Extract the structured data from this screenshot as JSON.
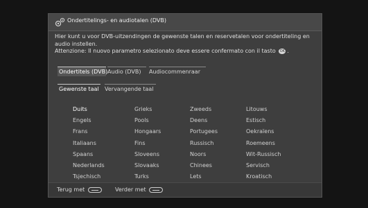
{
  "header": {
    "title": "Ondertitelings- en audiotalen (DVB)",
    "icon": "gears-icon"
  },
  "description": {
    "line1": "Hier kunt u voor DVB-uitzendingen de gewenste talen en reservetalen voor ondertiteling en audio instellen.",
    "line2_before": "Attenzione: Il nuovo parametro selezionato deve essere confermato con il tasto",
    "ok_key": "OK",
    "line2_after": "."
  },
  "tabs": [
    {
      "label": "Ondertitels (DVB)"
    },
    {
      "label": "Audio (DVB)"
    },
    {
      "label": "Audiocommenraar"
    }
  ],
  "subtabs": [
    {
      "label": "Gewenste taal"
    },
    {
      "label": "Vervangende taal"
    }
  ],
  "languages": {
    "columns": [
      [
        "Duits",
        "Engels",
        "Frans",
        "Italiaans",
        "Spaans",
        "Nederlands",
        "Tsjechisch"
      ],
      [
        "Grieks",
        "Pools",
        "Hongaars",
        "Fins",
        "Sloveens",
        "Slovaaks",
        "Turks"
      ],
      [
        "Zweeds",
        "Deens",
        "Portugees",
        "Russisch",
        "Noors",
        "Chinees",
        "Lets"
      ],
      [
        "Litouws",
        "Estisch",
        "Oekraïens",
        "Roemeens",
        "Wit-Russisch",
        "Servisch",
        "Kroatisch"
      ]
    ],
    "selected": "Duits"
  },
  "footer": {
    "back_label": "Terug met",
    "forward_label": "Verder met"
  },
  "colors": {
    "panel": "#3e3e3e",
    "background": "#141414",
    "text": "#e8e8e8"
  }
}
